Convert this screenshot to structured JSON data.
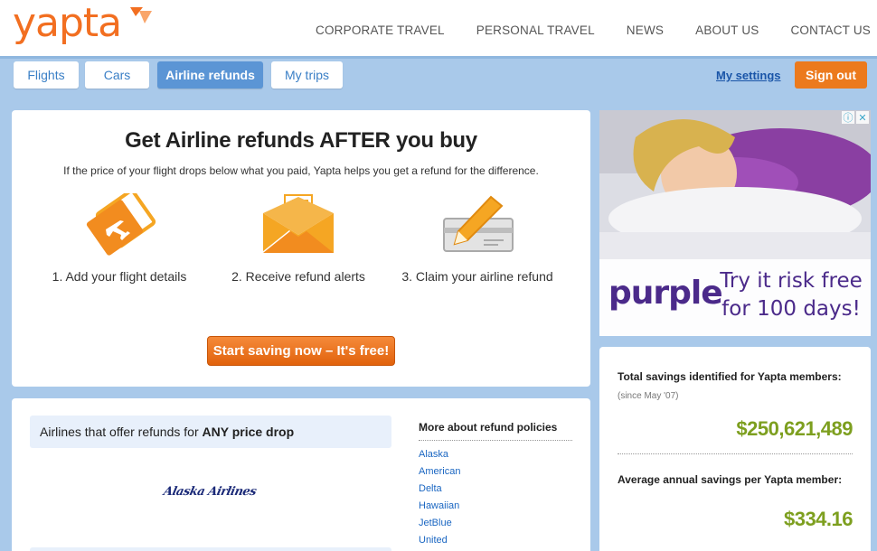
{
  "brand": {
    "logo_text": "yapta",
    "accent": "#f26f21"
  },
  "top_nav": [
    "CORPORATE TRAVEL",
    "PERSONAL TRAVEL",
    "NEWS",
    "ABOUT US",
    "CONTACT US"
  ],
  "tabs": [
    {
      "label": "Flights",
      "active": false
    },
    {
      "label": "Cars",
      "active": false
    },
    {
      "label": "Airline refunds",
      "active": true
    },
    {
      "label": "My trips",
      "active": false
    }
  ],
  "account": {
    "settings_label": "My settings",
    "signout_label": "Sign out"
  },
  "hero": {
    "title": "Get Airline refunds AFTER you buy",
    "subtitle": "If the price of your flight drops below what you paid, Yapta helps you get a refund for the difference.",
    "steps": [
      {
        "icon": "ticket-icon",
        "label": "1. Add your flight details"
      },
      {
        "icon": "envelope-icon",
        "label": "2. Receive refund alerts"
      },
      {
        "icon": "pencil-check-icon",
        "label": "3. Claim your airline refund"
      }
    ],
    "cta_label": "Start saving now – It's free!"
  },
  "refunds": {
    "box_prefix": "Airlines that offer refunds for ",
    "box_bold": "ANY price drop",
    "airline_logo_text": "Alaska Airlines",
    "more_title": "More about refund policies",
    "airlines": [
      "Alaska",
      "American",
      "Delta",
      "Hawaiian",
      "JetBlue",
      "United"
    ]
  },
  "ad": {
    "brand": "purple",
    "copy_line1": "Try it risk free",
    "copy_line2": "for 100 days!",
    "info_icon": "info-icon",
    "close_icon": "close-icon"
  },
  "savings": {
    "total_label": "Total savings identified for Yapta members:",
    "total_note": "(since May '07)",
    "total_value": "$250,621,489",
    "avg_label": "Average annual savings per Yapta member:",
    "avg_value": "$334.16",
    "value_color": "#7d9f1f"
  }
}
